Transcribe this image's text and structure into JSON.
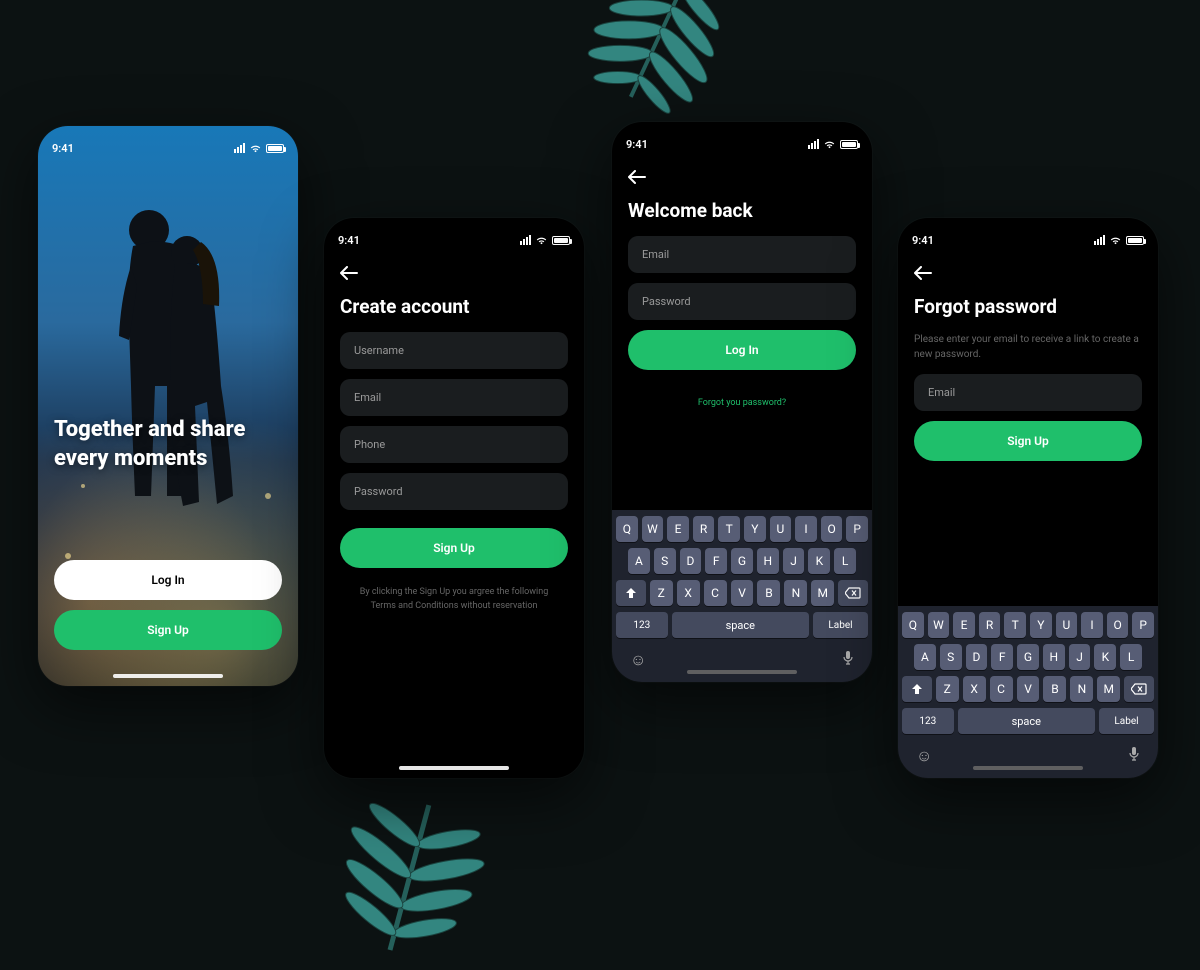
{
  "status": {
    "time": "9:41"
  },
  "colors": {
    "accent": "#1fbf6b"
  },
  "screen1": {
    "tagline": "Together and share every moments",
    "login": "Log In",
    "signup": "Sign Up"
  },
  "screen2": {
    "title": "Create account",
    "fields": {
      "username": "Username",
      "email": "Email",
      "phone": "Phone",
      "password": "Password"
    },
    "cta": "Sign Up",
    "disclaimer": "By clicking the Sign Up you argree the following Terms and Conditions without reservation"
  },
  "screen3": {
    "title": "Welcome back",
    "fields": {
      "email": "Email",
      "password": "Password"
    },
    "cta": "Log In",
    "forgot": "Forgot you password?"
  },
  "screen4": {
    "title": "Forgot password",
    "sub": "Please enter your email to receive a link to create a new password.",
    "fields": {
      "email": "Email"
    },
    "cta": "Sign Up"
  },
  "keyboard": {
    "row1": [
      "Q",
      "W",
      "E",
      "R",
      "T",
      "Y",
      "U",
      "I",
      "O",
      "P"
    ],
    "row2": [
      "A",
      "S",
      "D",
      "F",
      "G",
      "H",
      "J",
      "K",
      "L"
    ],
    "row3": [
      "Z",
      "X",
      "C",
      "V",
      "B",
      "N",
      "M"
    ],
    "num": "123",
    "space": "space",
    "label": "Label"
  }
}
